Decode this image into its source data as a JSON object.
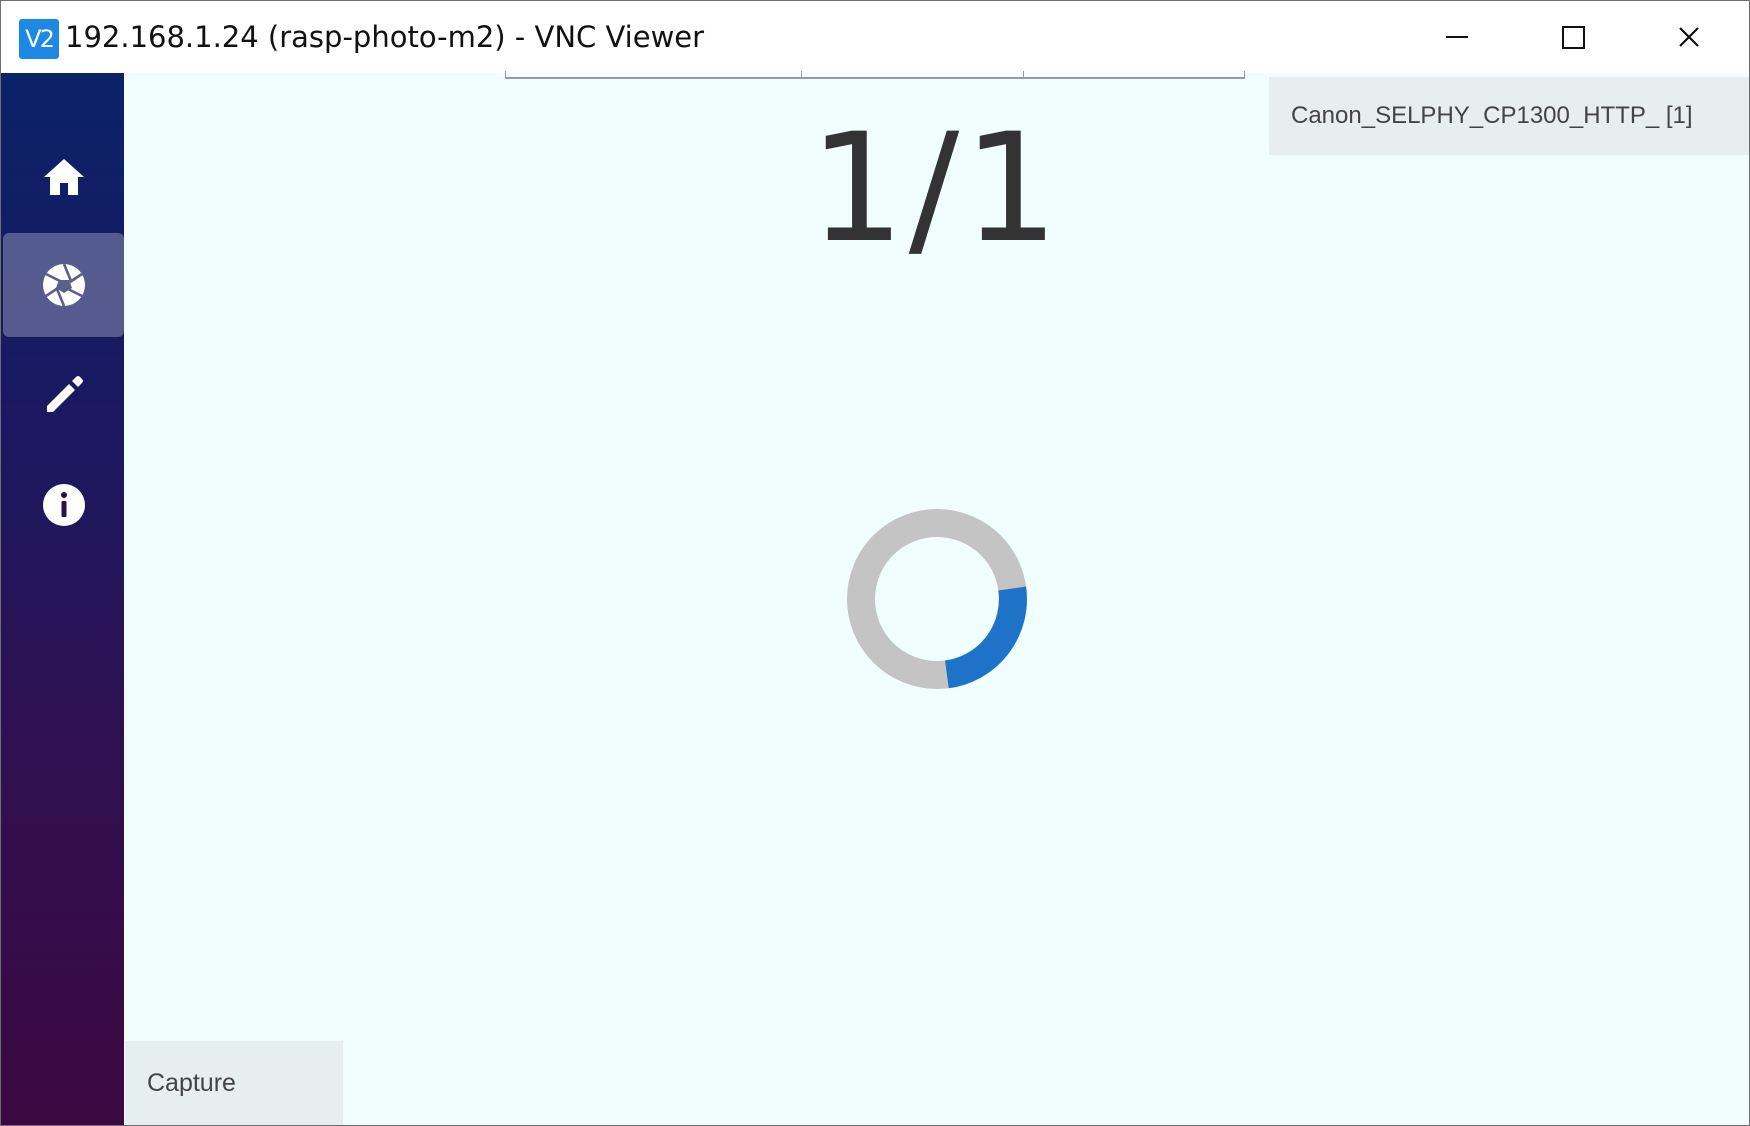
{
  "window": {
    "app_icon_text": "V2",
    "title": "192.168.1.24 (rasp-photo-m2) - VNC Viewer",
    "controls": {
      "minimize": "minimize-icon",
      "maximize": "maximize-icon",
      "close": "close-icon"
    }
  },
  "sidebar": {
    "items": [
      {
        "id": "home",
        "icon": "home-icon",
        "active": false
      },
      {
        "id": "capture",
        "icon": "camera-shutter-icon",
        "active": true
      },
      {
        "id": "edit",
        "icon": "pencil-icon",
        "active": false
      },
      {
        "id": "info",
        "icon": "info-icon",
        "active": false
      }
    ],
    "colors": {
      "top": "#0b2268",
      "bottom": "#3c0842"
    }
  },
  "main": {
    "counter": "1/1",
    "printer": "Canon_SELPHY_CP1300_HTTP_ [1]",
    "spinner": {
      "track_color": "#c4c4c4",
      "arc_color": "#1e73c8"
    },
    "capture_button_label": "Capture",
    "background": "#f1fefe"
  }
}
